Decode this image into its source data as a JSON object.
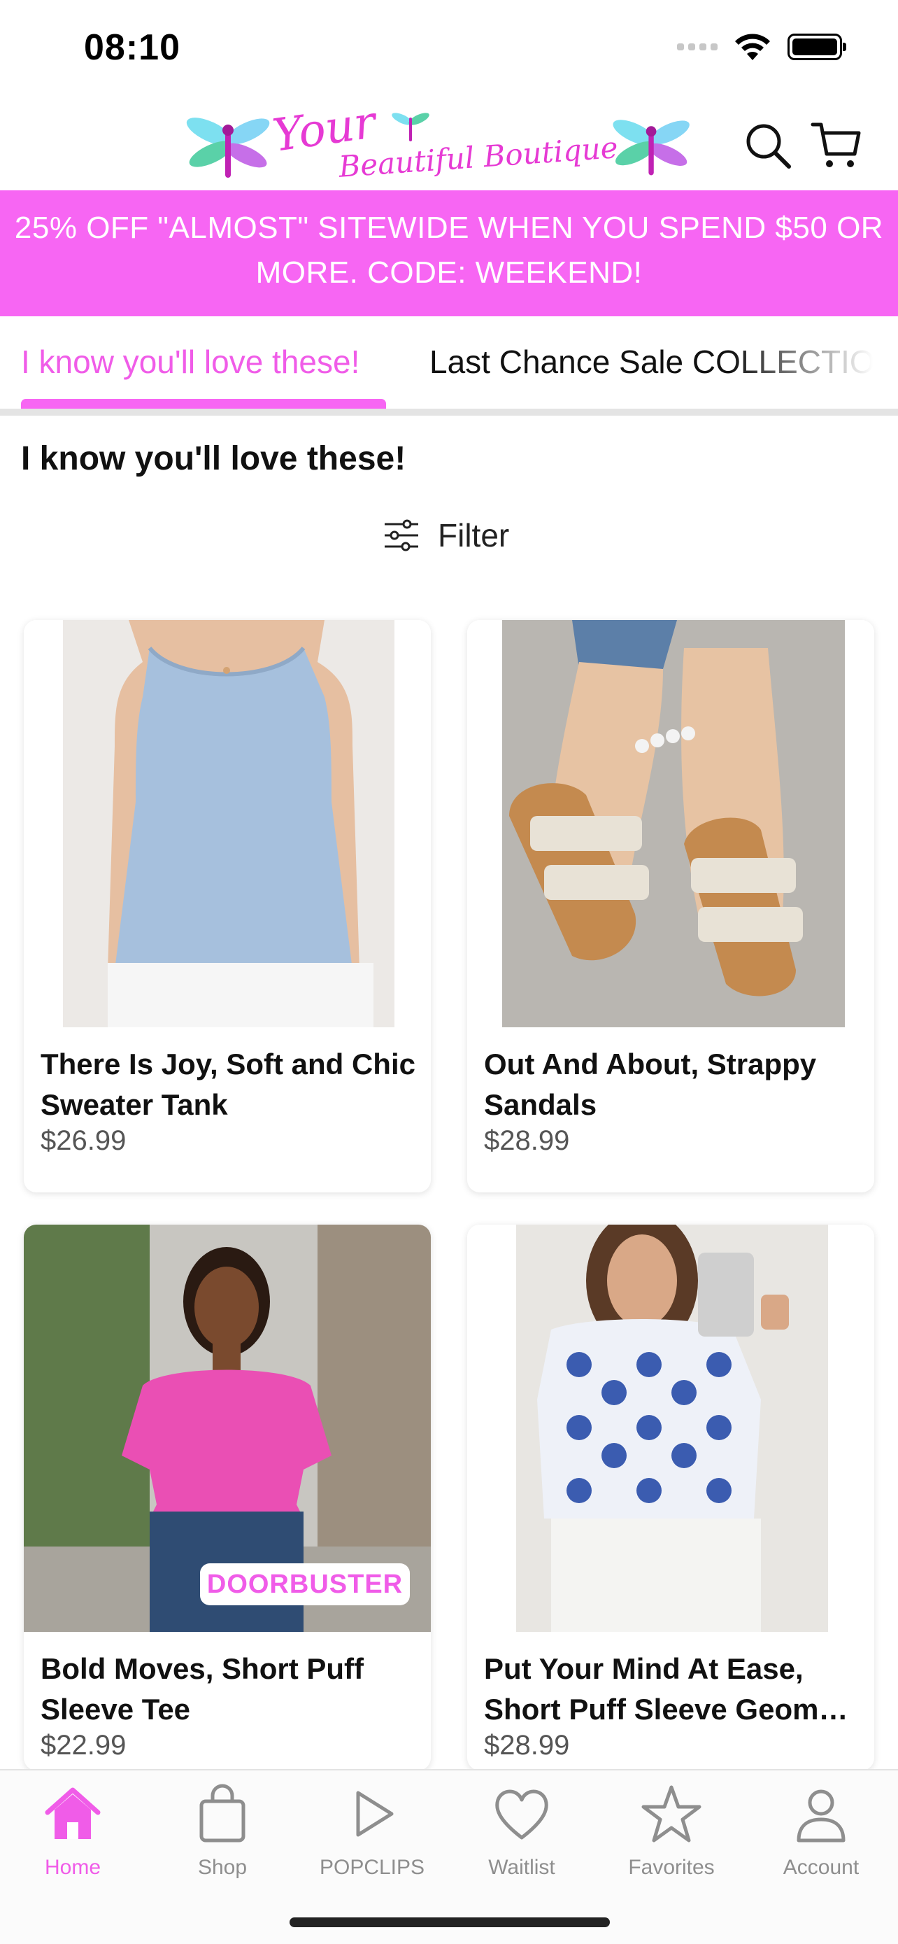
{
  "status_bar": {
    "time": "08:10"
  },
  "header": {
    "logo_line_1": "Your",
    "logo_line_2": "Beautiful Boutique",
    "brand_color": "#e63ad4"
  },
  "promo": {
    "text": "25% OFF \"ALMOST\" SITEWIDE WHEN YOU SPEND $50 OR MORE. CODE: WEEKEND!",
    "color": "#f766f3"
  },
  "tabs": [
    {
      "label": "I know you'll love these!",
      "active": true
    },
    {
      "label": "Last Chance Sale COLLECTIO",
      "active": false
    }
  ],
  "collection": {
    "heading": "I know you'll love these!",
    "filter_label": "Filter"
  },
  "products": [
    {
      "title": "There Is Joy, Soft and Chic Sweater Tank",
      "price": "$26.99",
      "badge": ""
    },
    {
      "title": "Out And About, Strappy Sandals",
      "price": "$28.99",
      "badge": ""
    },
    {
      "title": "Bold Moves, Short Puff Sleeve Tee",
      "price": "$22.99",
      "badge": "DOORBUSTER"
    },
    {
      "title": "Put Your Mind At Ease, Short Puff Sleeve Geom…",
      "price": "$28.99",
      "badge": ""
    }
  ],
  "bottom_nav": [
    {
      "label": "Home",
      "icon": "home-icon",
      "active": true
    },
    {
      "label": "Shop",
      "icon": "shopping-bag-icon",
      "active": false
    },
    {
      "label": "POPCLIPS",
      "icon": "play-icon",
      "active": false
    },
    {
      "label": "Waitlist",
      "icon": "heart-icon",
      "active": false
    },
    {
      "label": "Favorites",
      "icon": "star-icon",
      "active": false
    },
    {
      "label": "Account",
      "icon": "person-icon",
      "active": false
    }
  ],
  "accent_color": "#f05ce8"
}
